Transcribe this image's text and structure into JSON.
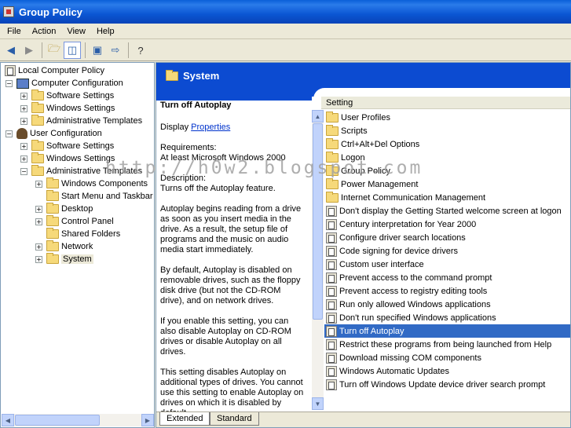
{
  "window": {
    "title": "Group Policy"
  },
  "menu": [
    "File",
    "Action",
    "View",
    "Help"
  ],
  "tree": {
    "root": "Local Computer Policy",
    "computer_config": "Computer Configuration",
    "computer_children": [
      "Software Settings",
      "Windows Settings",
      "Administrative Templates"
    ],
    "user_config": "User Configuration",
    "user_children": [
      "Software Settings",
      "Windows Settings",
      "Administrative Templates"
    ],
    "admin_children": [
      "Windows Components",
      "Start Menu and Taskbar",
      "Desktop",
      "Control Panel",
      "Shared Folders",
      "Network",
      "System"
    ],
    "selected": "System"
  },
  "banner": {
    "title": "System"
  },
  "extended": {
    "title": "Turn off Autoplay",
    "display_label": "Display",
    "properties_link": "Properties",
    "requirements_label": "Requirements:",
    "requirements_value": "At least Microsoft Windows 2000",
    "description_label": "Description:",
    "description_lines": [
      "Turns off the Autoplay feature.",
      "",
      "Autoplay begins reading from a drive",
      "as soon as you insert media in the",
      "drive. As a result, the setup file of",
      "programs and the music on audio",
      "media start immediately.",
      "",
      "By default, Autoplay is disabled on",
      "removable drives, such as the floppy",
      "disk drive (but not the CD-ROM",
      "drive), and on network drives.",
      "",
      "If you enable this setting, you can",
      "also disable Autoplay on CD-ROM",
      "drives or disable Autoplay on all",
      "drives.",
      "",
      "This setting disables Autoplay on",
      "additional types of drives. You cannot",
      "use this setting to enable Autoplay on",
      "drives on which it is disabled by",
      "default."
    ]
  },
  "list": {
    "header": "Setting",
    "folders": [
      "User Profiles",
      "Scripts",
      "Ctrl+Alt+Del Options",
      "Logon",
      "Group Policy",
      "Power Management",
      "Internet Communication Management"
    ],
    "policies": [
      "Don't display the Getting Started welcome screen at logon",
      "Century interpretation for Year 2000",
      "Configure driver search locations",
      "Code signing for device drivers",
      "Custom user interface",
      "Prevent access to the command prompt",
      "Prevent access to registry editing tools",
      "Run only allowed Windows applications",
      "Don't run specified Windows applications",
      "Turn off Autoplay",
      "Restrict these programs from being launched from Help",
      "Download missing COM components",
      "Windows Automatic Updates",
      "Turn off Windows Update device driver search prompt"
    ],
    "selected": "Turn off Autoplay"
  },
  "tabs": [
    "Extended",
    "Standard"
  ],
  "watermark": "http://h0w2.blogspot.com"
}
